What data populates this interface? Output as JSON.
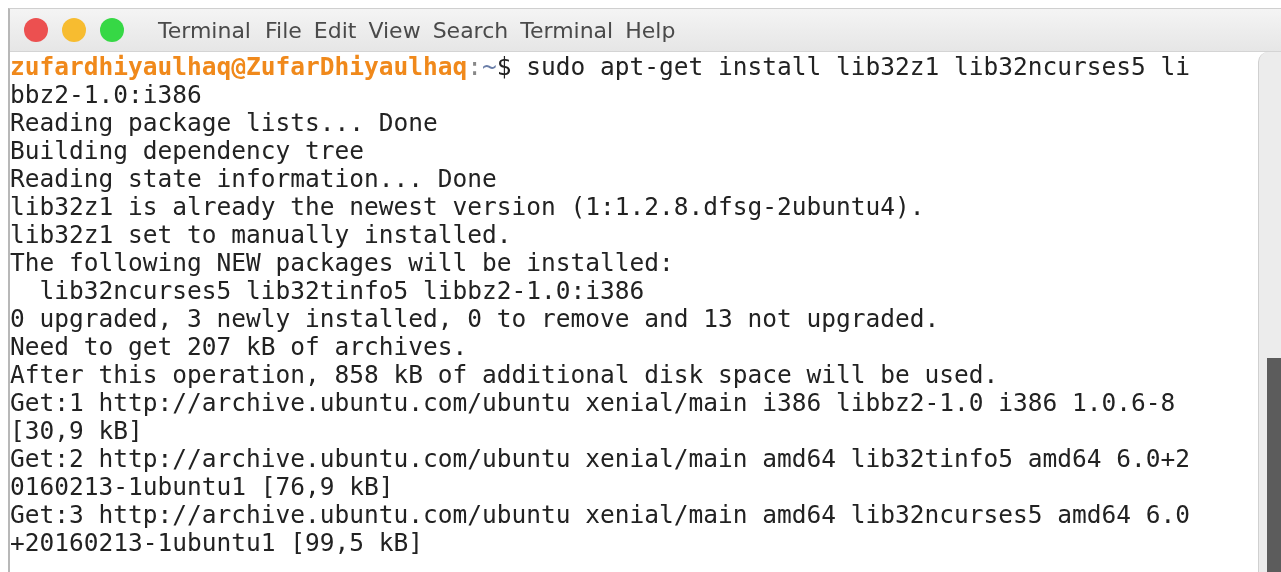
{
  "window": {
    "app_name": "Terminal",
    "menu": [
      "File",
      "Edit",
      "View",
      "Search",
      "Terminal",
      "Help"
    ]
  },
  "terminal": {
    "prompt": {
      "user_host": "zufardhiyaulhaq@ZufarDhiyaulhaq",
      "separator": ":",
      "path": "~",
      "symbol": "$",
      "command": " sudo apt-get install lib32z1 lib32ncurses5 li"
    },
    "lines": [
      "bbz2-1.0:i386",
      "Reading package lists... Done",
      "Building dependency tree",
      "Reading state information... Done",
      "lib32z1 is already the newest version (1:1.2.8.dfsg-2ubuntu4).",
      "lib32z1 set to manually installed.",
      "The following NEW packages will be installed:",
      "  lib32ncurses5 lib32tinfo5 libbz2-1.0:i386",
      "0 upgraded, 3 newly installed, 0 to remove and 13 not upgraded.",
      "Need to get 207 kB of archives.",
      "After this operation, 858 kB of additional disk space will be used.",
      "Get:1 http://archive.ubuntu.com/ubuntu xenial/main i386 libbz2-1.0 i386 1.0.6-8",
      "[30,9 kB]",
      "Get:2 http://archive.ubuntu.com/ubuntu xenial/main amd64 lib32tinfo5 amd64 6.0+2",
      "0160213-1ubuntu1 [76,9 kB]",
      "Get:3 http://archive.ubuntu.com/ubuntu xenial/main amd64 lib32ncurses5 amd64 6.0",
      "+20160213-1ubuntu1 [99,5 kB]"
    ]
  }
}
